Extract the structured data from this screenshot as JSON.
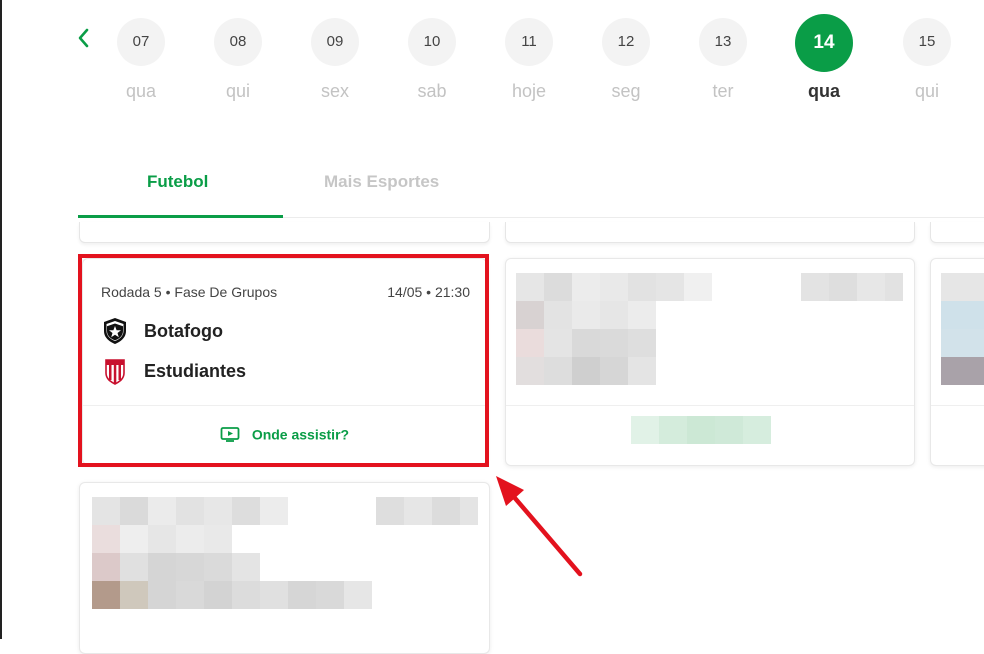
{
  "dates": [
    {
      "num": "07",
      "dow": "qua",
      "active": false
    },
    {
      "num": "08",
      "dow": "qui",
      "active": false
    },
    {
      "num": "09",
      "dow": "sex",
      "active": false
    },
    {
      "num": "10",
      "dow": "sab",
      "active": false
    },
    {
      "num": "11",
      "dow": "hoje",
      "active": false
    },
    {
      "num": "12",
      "dow": "seg",
      "active": false
    },
    {
      "num": "13",
      "dow": "ter",
      "active": false
    },
    {
      "num": "14",
      "dow": "qua",
      "active": true
    },
    {
      "num": "15",
      "dow": "qui",
      "active": false
    }
  ],
  "tabs": [
    {
      "label": "Futebol",
      "active": true
    },
    {
      "label": "Mais Esportes",
      "active": false
    }
  ],
  "match": {
    "stage": "Rodada 5 • Fase De Grupos",
    "datetime": "14/05 • 21:30",
    "home": {
      "name": "Botafogo",
      "crest": "botafogo-star-crest-icon"
    },
    "away": {
      "name": "Estudiantes",
      "crest": "estudiantes-striped-crest-icon"
    },
    "watch_label": "Onde assistir?",
    "watch_icon": "tv-play-icon"
  },
  "colors": {
    "accent": "#0a9d47",
    "highlight": "#e3121e"
  }
}
